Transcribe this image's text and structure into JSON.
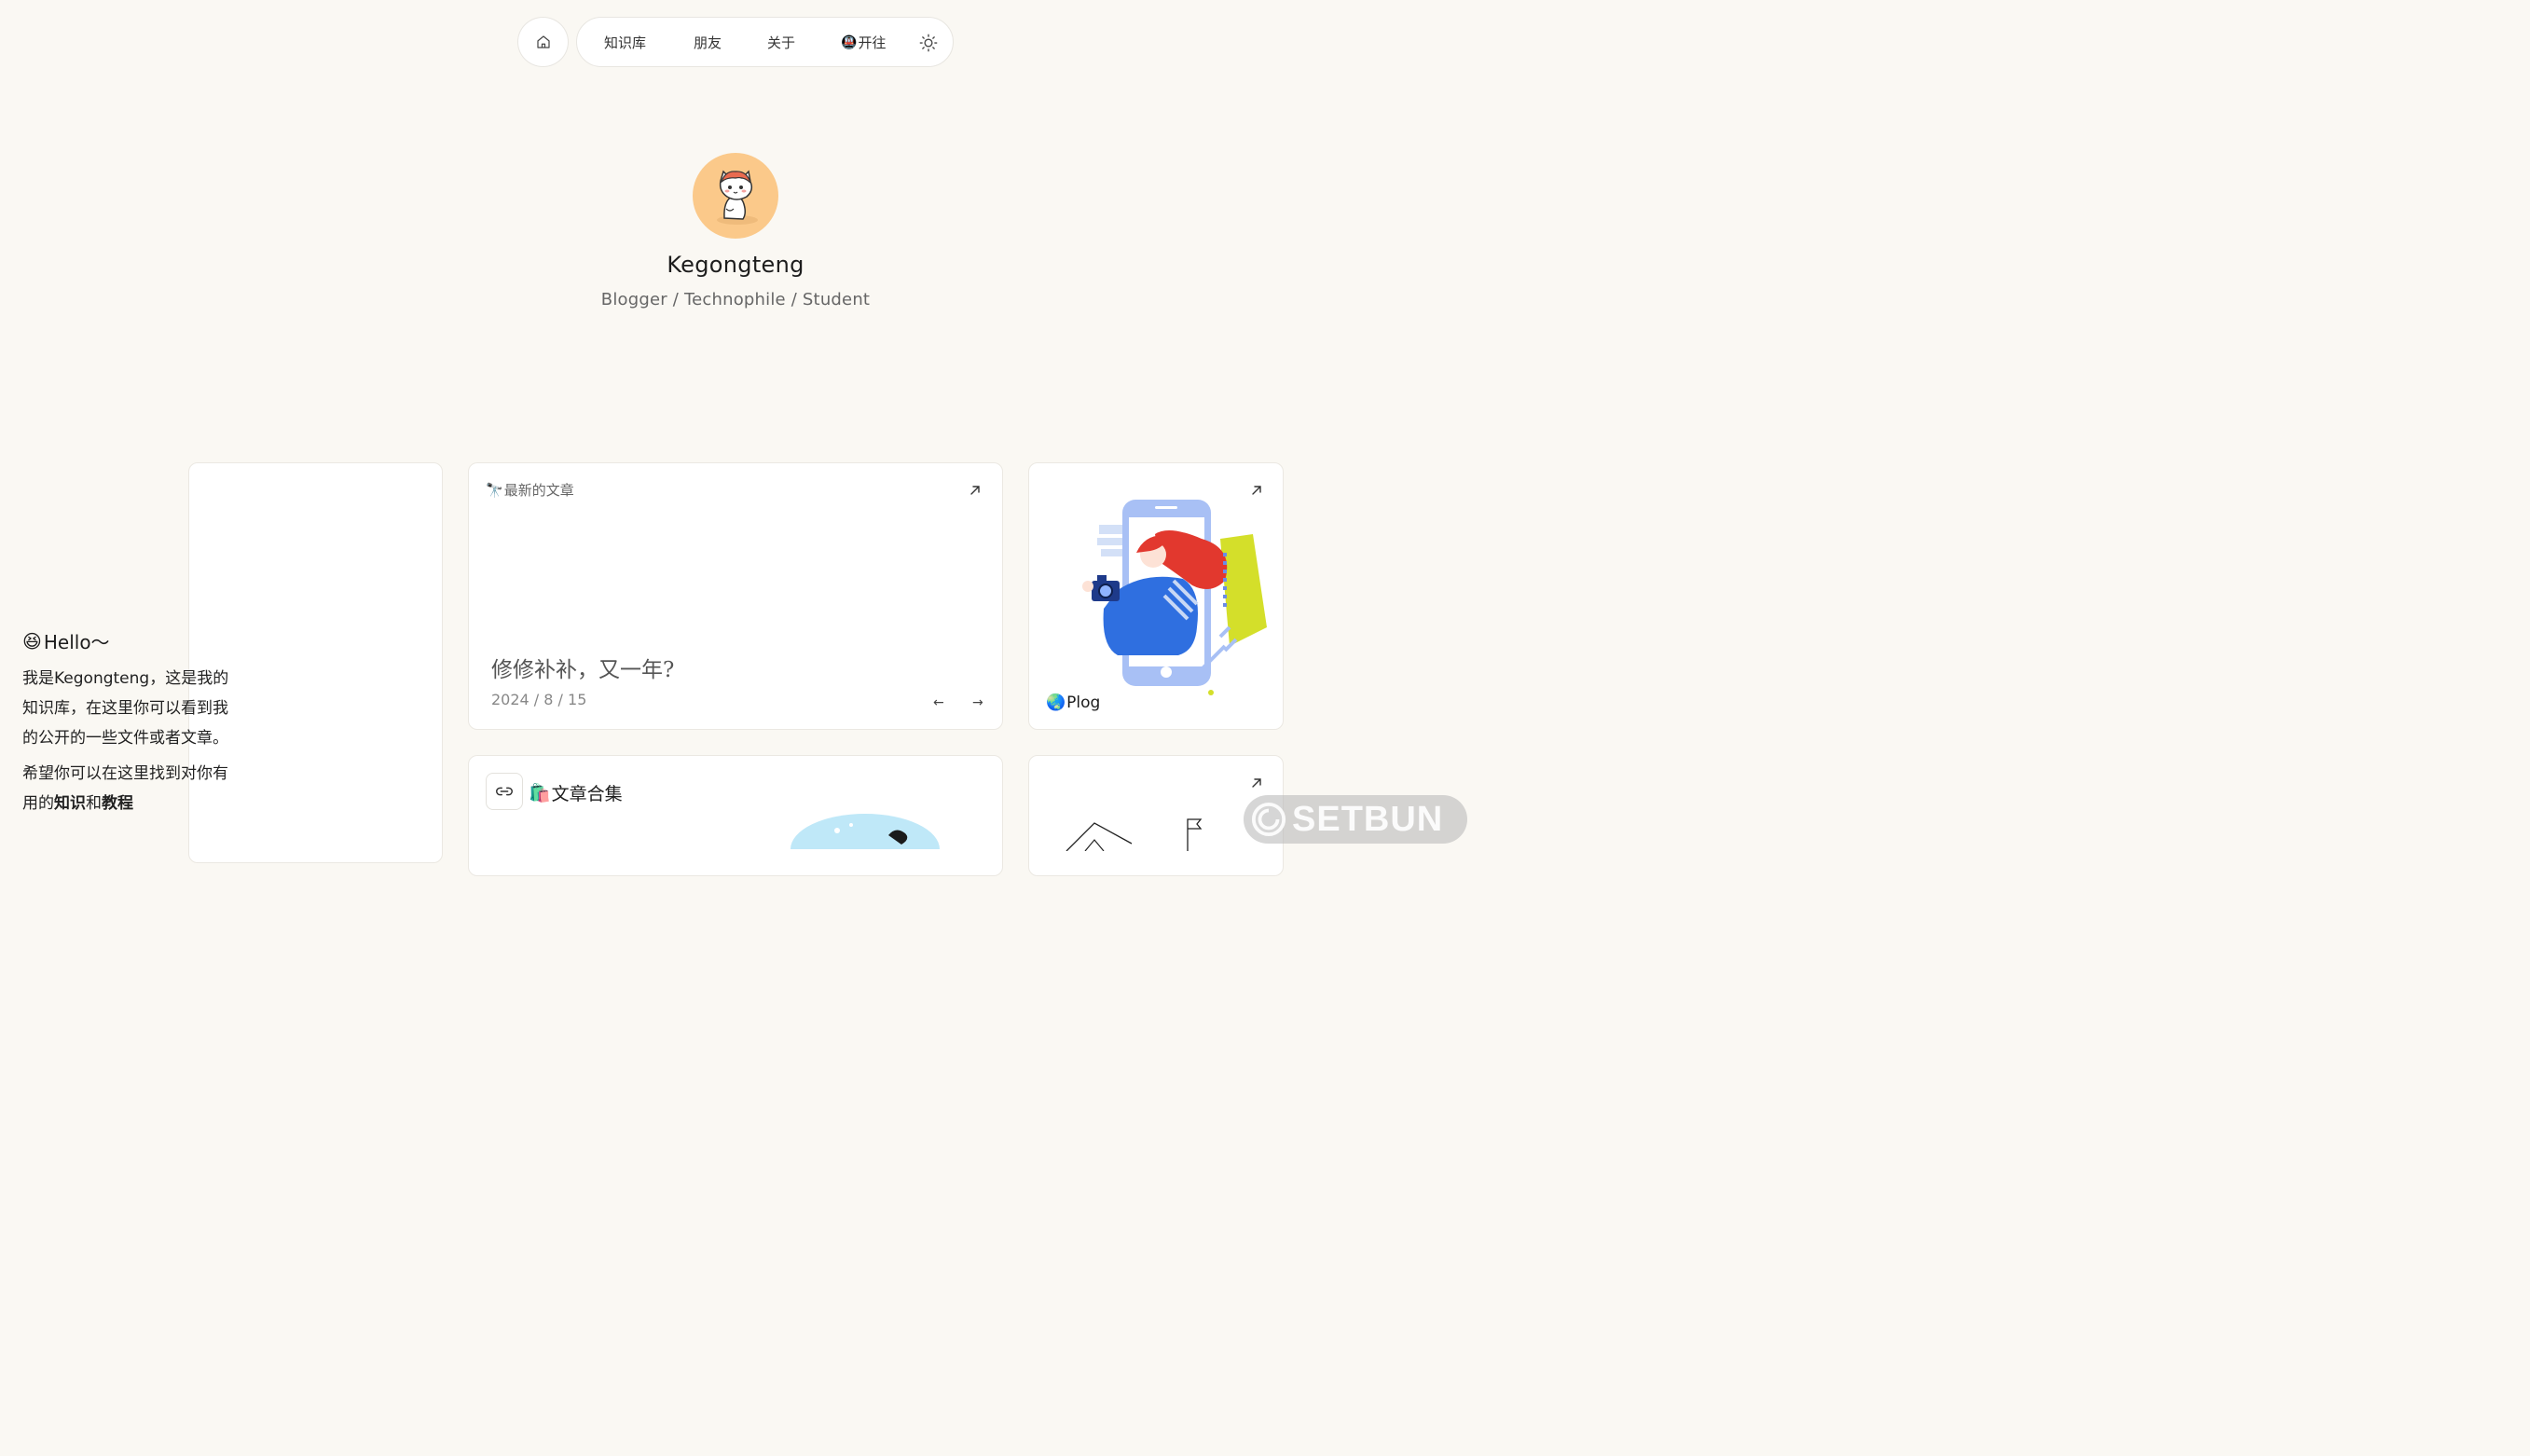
{
  "nav": {
    "home_icon": "home-icon",
    "items": [
      {
        "label": "知识库"
      },
      {
        "label": "朋友"
      },
      {
        "label": "关于"
      },
      {
        "emoji": "🚇",
        "label": "开往"
      }
    ],
    "theme_icon": "sun-icon"
  },
  "profile": {
    "name": "Kegongteng",
    "tagline": "Blogger / Technophile / Student",
    "avatar_bg": "#fbc98a"
  },
  "hello": {
    "emoji": "😆",
    "title": "Hello～",
    "para1": "我是Kegongteng，这是我的知识库，在这里你可以看到我的公开的一些文件或者文章。",
    "para2_prefix": "希望你可以在这里找到对你有用的",
    "para2_bold1": "知识",
    "para2_mid": "和",
    "para2_bold2": "教程"
  },
  "latest": {
    "emoji": "🔭",
    "label": "最新的文章",
    "title": "修修补补，又一年?",
    "date": "2024 / 8 / 15",
    "prev": "←",
    "next": "→"
  },
  "plog": {
    "emoji": "🌏",
    "label": "Plog"
  },
  "collection": {
    "emoji": "🛍️",
    "label": "文章合集"
  },
  "watermark": {
    "text": "SETBUN"
  }
}
